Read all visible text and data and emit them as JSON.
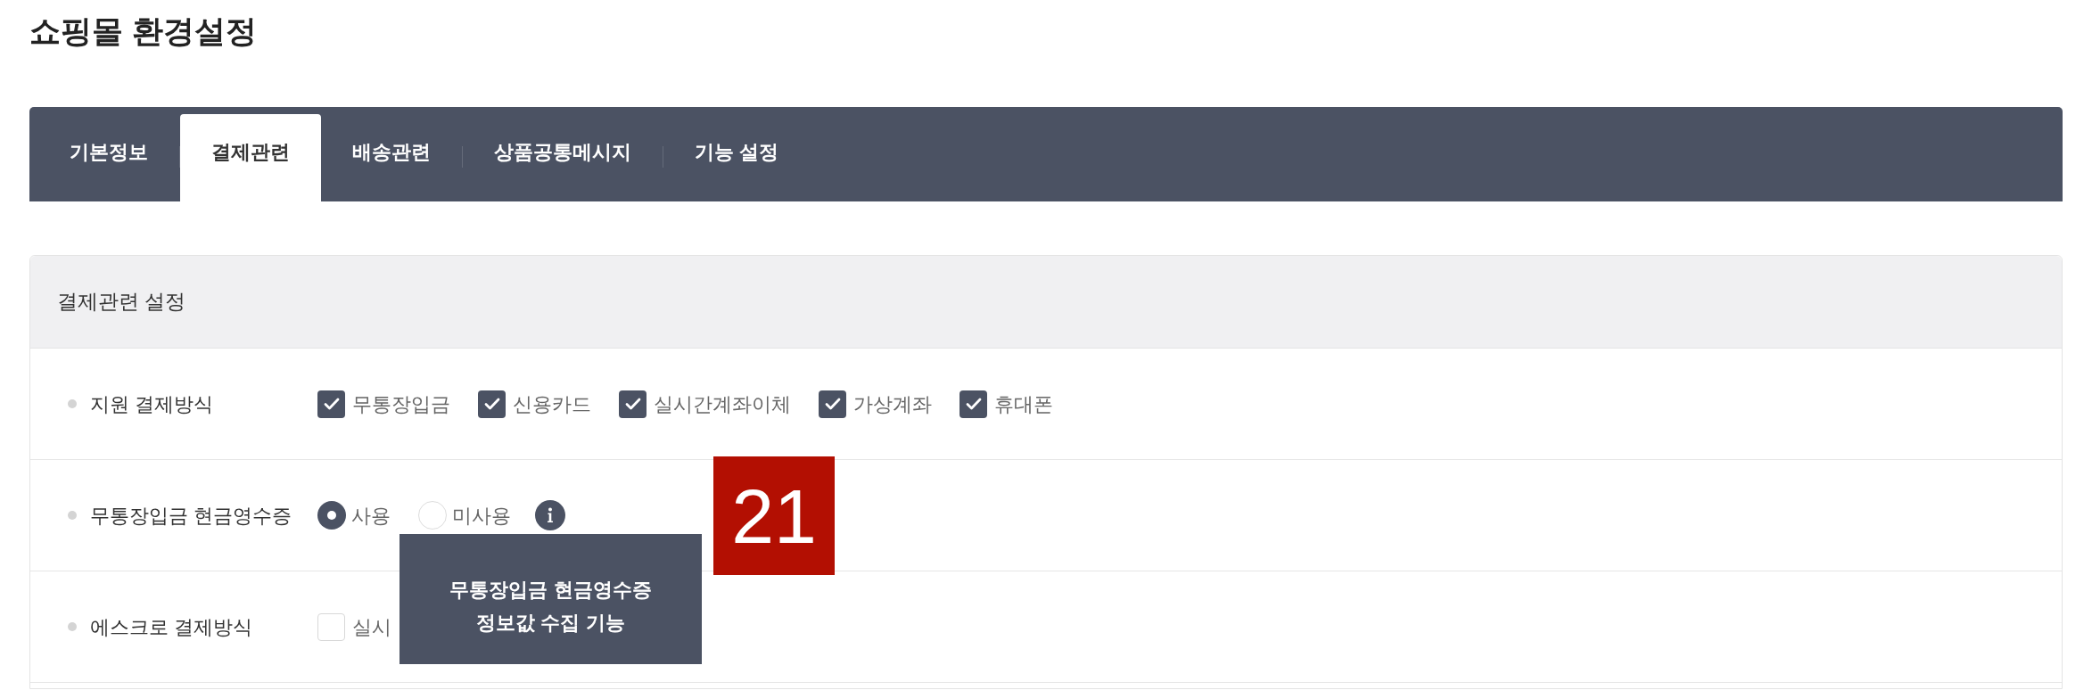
{
  "page": {
    "title": "쇼핑몰 환경설정"
  },
  "tabs": [
    {
      "label": "기본정보",
      "selected": false
    },
    {
      "label": "결제관련",
      "selected": true
    },
    {
      "label": "배송관련",
      "selected": false
    },
    {
      "label": "상품공통메시지",
      "selected": false
    },
    {
      "label": "기능 설정",
      "selected": false
    }
  ],
  "settings_panel": {
    "title": "결제관련 설정",
    "rows": [
      {
        "label": "지원 결제방식",
        "kind": "checkboxes",
        "options": [
          {
            "label": "무통장입금",
            "checked": true
          },
          {
            "label": "신용카드",
            "checked": true
          },
          {
            "label": "실시간계좌이체",
            "checked": true
          },
          {
            "label": "가상계좌",
            "checked": true
          },
          {
            "label": "휴대폰",
            "checked": true
          }
        ]
      },
      {
        "label": "무통장입금 현금영수증",
        "kind": "radios",
        "options": [
          {
            "label": "사용",
            "selected": true
          },
          {
            "label": "미사용",
            "selected": false
          }
        ],
        "info_tooltip": "무통장입금 현금영수증\n정보값 수집 기능"
      },
      {
        "label": "에스크로 결제방식",
        "kind": "checkboxes",
        "options": [
          {
            "label": "실시",
            "checked": false
          }
        ]
      }
    ]
  },
  "step_marker": {
    "label": "21"
  }
}
